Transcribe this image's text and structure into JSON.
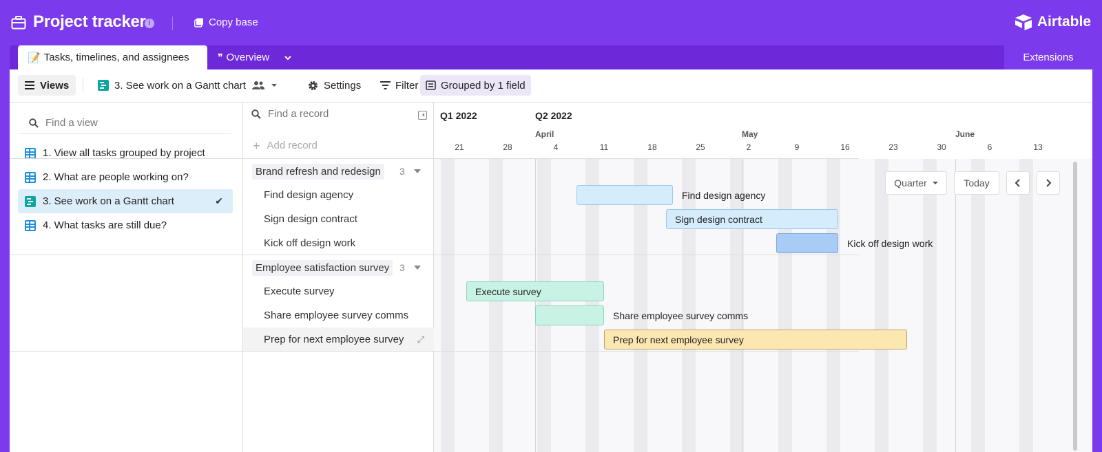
{
  "header": {
    "base_title": "Project tracker",
    "copy_label": "Copy base",
    "logo": "Airtable",
    "colors": {
      "brand": "#7c3aed",
      "tabbar": "#6d28d9"
    }
  },
  "tabs": {
    "active": "Tasks, timelines, and assignees",
    "active_emoji": "📝",
    "second": "Overview",
    "second_glyph": "❞",
    "extensions": "Extensions"
  },
  "toolbar": {
    "views_label": "Views",
    "current_view": "3. See work on a Gantt chart",
    "settings": "Settings",
    "filter": "Filter",
    "group": "Grouped by 1 field"
  },
  "sidebar": {
    "search_placeholder": "Find a view",
    "items": [
      {
        "label": "1. View all tasks grouped by project",
        "icon": "grid-icon"
      },
      {
        "label": "2. What are people working on?",
        "icon": "grid-icon"
      },
      {
        "label": "3. See work on a Gantt chart",
        "icon": "gantt-icon",
        "selected": true
      },
      {
        "label": "4. What tasks are still due?",
        "icon": "grid-icon"
      }
    ],
    "check": "✔"
  },
  "records": {
    "search_placeholder": "Find a record",
    "add_label": "Add record",
    "groups": [
      {
        "name": "Brand refresh and redesign",
        "count": "3",
        "rows": [
          "Find design agency",
          "Sign design contract",
          "Kick off design work"
        ]
      },
      {
        "name": "Employee satisfaction survey",
        "count": "3",
        "rows": [
          "Execute survey",
          "Share employee survey comms",
          "Prep for next employee survey"
        ]
      }
    ]
  },
  "timeline": {
    "quarters": [
      "Q1 2022",
      "Q2 2022"
    ],
    "months": [
      "April",
      "May",
      "June"
    ],
    "days": [
      "21",
      "28",
      "4",
      "11",
      "18",
      "25",
      "2",
      "9",
      "16",
      "23",
      "30",
      "6",
      "13"
    ],
    "controls": {
      "zoom": "Quarter",
      "today": "Today",
      "prev": "‹",
      "next": "›"
    },
    "bars": [
      {
        "name": "Find design agency",
        "start": "2022-04-07",
        "end": "2022-04-21",
        "color": "#d4ecfb",
        "border": "#9cc9e8",
        "label_inside": false
      },
      {
        "name": "Sign design contract",
        "start": "2022-04-20",
        "end": "2022-05-15",
        "color": "#d4ecfb",
        "border": "#9cc9e8",
        "label_inside": true
      },
      {
        "name": "Kick off design work",
        "start": "2022-05-06",
        "end": "2022-05-15",
        "color": "#a9ccf7",
        "border": "#7ea9de",
        "label_inside": false
      },
      {
        "name": "Execute survey",
        "start": "2022-03-22",
        "end": "2022-04-11",
        "color": "#c8f3e4",
        "border": "#8cd6bd",
        "label_inside": true
      },
      {
        "name": "Share employee survey comms",
        "start": "2022-04-01",
        "end": "2022-04-11",
        "color": "#c8f3e4",
        "border": "#8cd6bd",
        "label_inside": false
      },
      {
        "name": "Prep for next employee survey",
        "start": "2022-04-11",
        "end": "2022-05-25",
        "color": "#fde7b0",
        "border": "#b9a26a",
        "label_inside": true
      }
    ]
  }
}
